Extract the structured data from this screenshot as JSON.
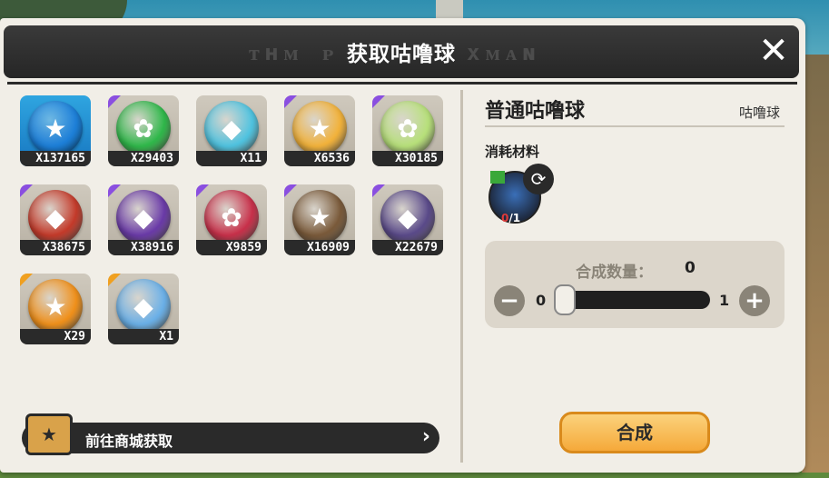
{
  "title": {
    "text": "获取咕噜球",
    "deco_left": "ᴛʜᴍ ᴘ",
    "deco_right": "xᴍᴀɴ",
    "close_label": "✕"
  },
  "items": [
    {
      "count": "X137165",
      "color": "#1d7fd8",
      "glyph": "★",
      "rarity": "none"
    },
    {
      "count": "X29403",
      "color": "#2fb84a",
      "glyph": "✿",
      "rarity": "purple"
    },
    {
      "count": "X11",
      "color": "#4fc3e0",
      "glyph": "◆",
      "rarity": "none"
    },
    {
      "count": "X6536",
      "color": "#f2b23a",
      "glyph": "★",
      "rarity": "purple"
    },
    {
      "count": "X30185",
      "color": "#b7e07a",
      "glyph": "✿",
      "rarity": "purple"
    },
    {
      "count": "X38675",
      "color": "#c43a2a",
      "glyph": "◆",
      "rarity": "purple"
    },
    {
      "count": "X38916",
      "color": "#6a3aa8",
      "glyph": "◆",
      "rarity": "purple"
    },
    {
      "count": "X9859",
      "color": "#c8304a",
      "glyph": "✿",
      "rarity": "purple"
    },
    {
      "count": "X16909",
      "color": "#7a5a3a",
      "glyph": "★",
      "rarity": "purple"
    },
    {
      "count": "X22679",
      "color": "#5a4a8a",
      "glyph": "◆",
      "rarity": "purple"
    },
    {
      "count": "X29",
      "color": "#f0901a",
      "glyph": "★",
      "rarity": "gold"
    },
    {
      "count": "X1",
      "color": "#6ab0e8",
      "glyph": "◆",
      "rarity": "gold"
    }
  ],
  "shop": {
    "label": "前往商城获取",
    "icon": "★"
  },
  "detail": {
    "name": "普通咕噜球",
    "category": "咕噜球",
    "materials_label": "消耗材料",
    "material_have": "0",
    "material_need": "/1"
  },
  "synth": {
    "label": "合成数量：",
    "value": "0",
    "min": "0",
    "max": "1",
    "minus": "−",
    "plus": "+",
    "fraction": 0
  },
  "confirm_label": "合成"
}
